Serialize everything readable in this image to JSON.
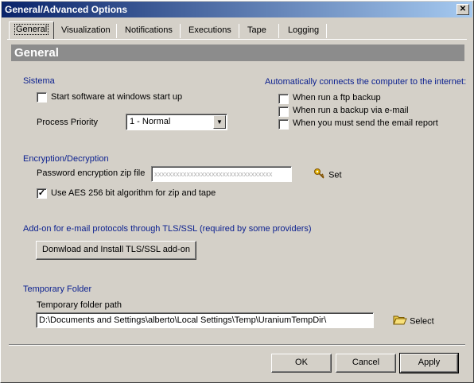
{
  "window": {
    "title": "General/Advanced Options",
    "close_glyph": "✕"
  },
  "tabs": [
    {
      "label": "General",
      "active": true
    },
    {
      "label": "Visualization",
      "active": false
    },
    {
      "label": "Notifications",
      "active": false
    },
    {
      "label": "Executions",
      "active": false
    },
    {
      "label": "Tape",
      "active": false
    },
    {
      "label": "Logging",
      "active": false
    }
  ],
  "header": {
    "title": "General"
  },
  "sistema": {
    "title": "Sistema",
    "startup_label": "Start software at windows start up",
    "startup_checked": false,
    "priority_label": "Process Priority",
    "priority_value": "1 - Normal"
  },
  "internet": {
    "title": "Automatically connects the computer to the internet:",
    "options": [
      {
        "label": "When run a ftp backup",
        "checked": false
      },
      {
        "label": "When run a backup via e-mail",
        "checked": false
      },
      {
        "label": "When you must send the email report",
        "checked": false
      }
    ]
  },
  "encryption": {
    "title": "Encryption/Decryption",
    "password_label": "Password encryption zip file",
    "password_value": "xxxxxxxxxxxxxxxxxxxxxxxxxxxxxxxxx",
    "set_label": "Set",
    "aes_label": "Use AES 256 bit algorithm for zip and tape",
    "aes_checked": true
  },
  "addon": {
    "title": "Add-on for e-mail protocols through TLS/SSL (required by some providers)",
    "button_label": "Donwload and Install TLS/SSL add-on"
  },
  "temp": {
    "title": "Temporary Folder",
    "path_label": "Temporary folder path",
    "path_value": "D:\\Documents and Settings\\alberto\\Local Settings\\Temp\\UraniumTempDir\\",
    "select_label": "Select"
  },
  "footer": {
    "ok_label": "OK",
    "cancel_label": "Cancel",
    "apply_label": "Apply"
  },
  "colors": {
    "section_title": "#0a1f8f",
    "title_bar_start": "#0a246a",
    "title_bar_end": "#a6caf0",
    "header_bar": "#8c8c8c"
  }
}
